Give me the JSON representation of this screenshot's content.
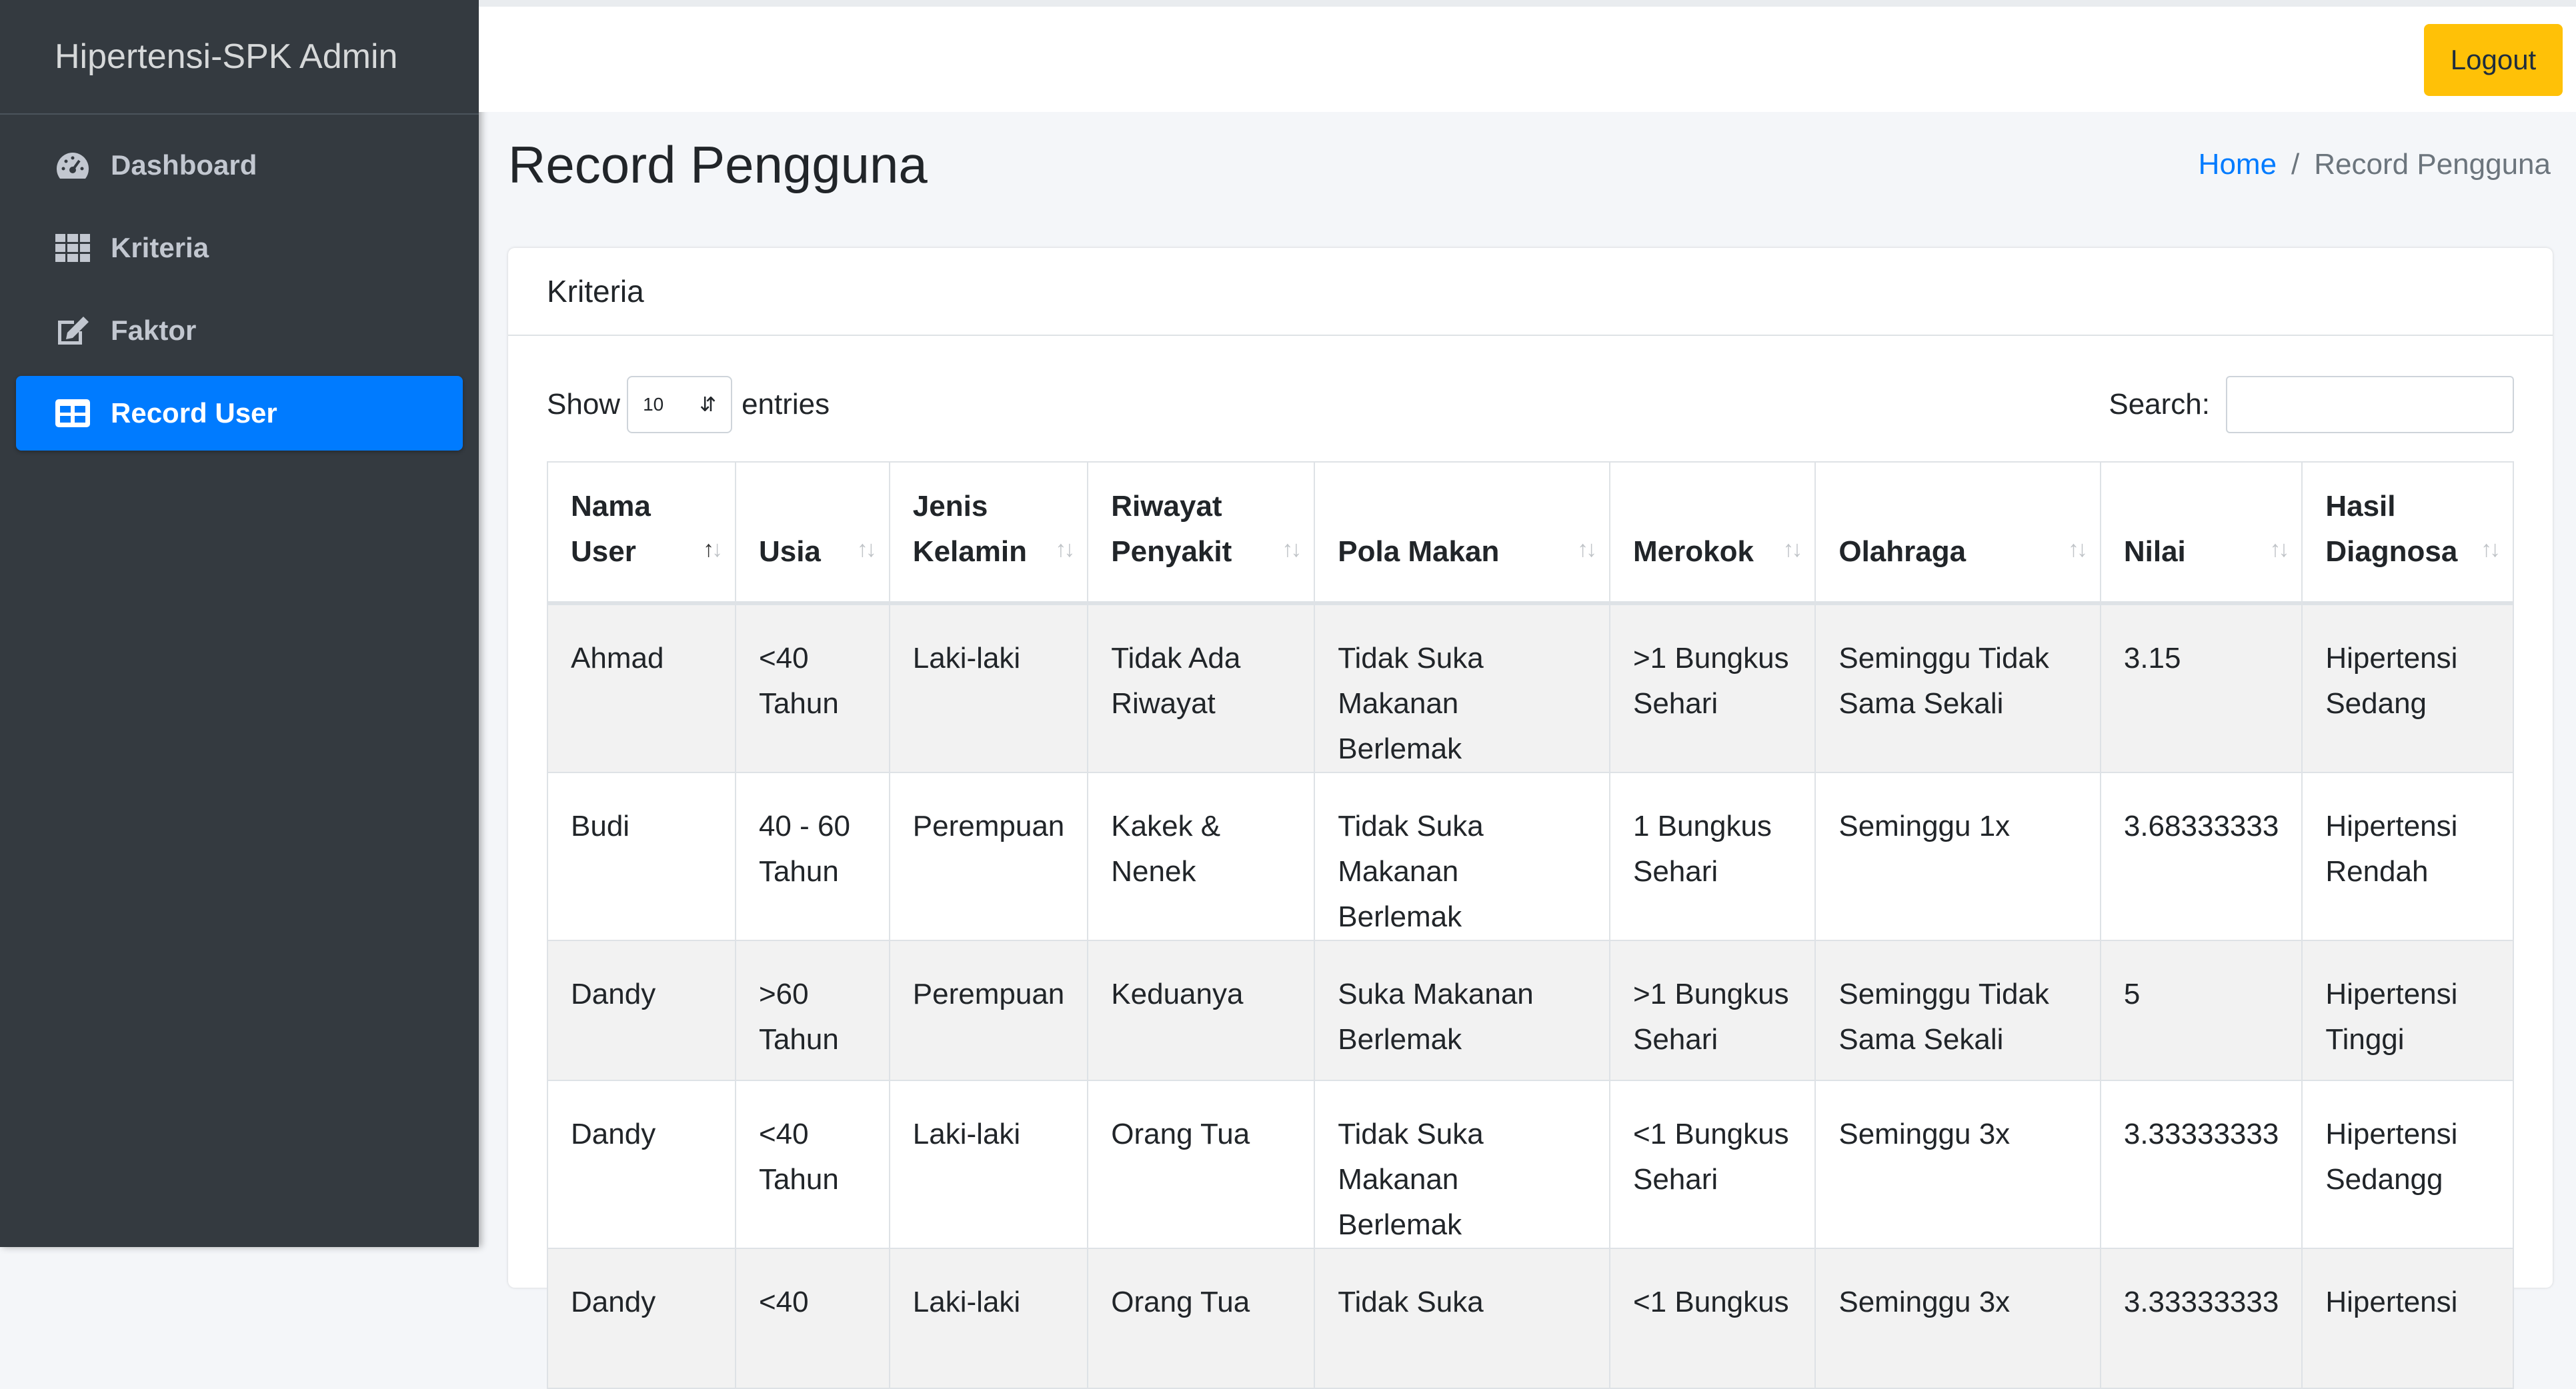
{
  "brand": "Hipertensi-SPK Admin",
  "sidebar": {
    "items": [
      {
        "label": "Dashboard",
        "icon": "tachometer-icon"
      },
      {
        "label": "Kriteria",
        "icon": "grid-icon"
      },
      {
        "label": "Faktor",
        "icon": "edit-icon"
      },
      {
        "label": "Record User",
        "icon": "table-icon",
        "active": true
      }
    ]
  },
  "topbar": {
    "logout_label": "Logout"
  },
  "header": {
    "title": "Record Pengguna",
    "breadcrumb": {
      "home": "Home",
      "separator": "/",
      "current": "Record Pengguna"
    }
  },
  "card": {
    "title": "Kriteria",
    "show_label": "Show",
    "entries_value": "10",
    "entries_label": "entries",
    "search_label": "Search:",
    "search_value": ""
  },
  "table": {
    "columns": [
      {
        "line1": "Nama",
        "line2": "User",
        "sort": "asc"
      },
      {
        "line1": "",
        "line2": "Usia"
      },
      {
        "line1": "Jenis",
        "line2": "Kelamin"
      },
      {
        "line1": "Riwayat",
        "line2": "Penyakit"
      },
      {
        "line1": "",
        "line2": "Pola Makan"
      },
      {
        "line1": "",
        "line2": "Merokok"
      },
      {
        "line1": "",
        "line2": "Olahraga"
      },
      {
        "line1": "",
        "line2": "Nilai"
      },
      {
        "line1": "Hasil",
        "line2": "Diagnosa"
      }
    ],
    "rows": [
      {
        "nama": "Ahmad",
        "usia1": "<40",
        "usia2": "Tahun",
        "jk": "Laki-laki",
        "rp1": "Tidak Ada",
        "rp2": "Riwayat",
        "pm1": "Tidak Suka",
        "pm2": "Makanan Berlemak",
        "mr1": ">1 Bungkus",
        "mr2": "Sehari",
        "ol1": "Seminggu Tidak",
        "ol2": "Sama Sekali",
        "nilai": "3.15",
        "hd1": "Hipertensi",
        "hd2": "Sedang"
      },
      {
        "nama": "Budi",
        "usia1": "40 - 60",
        "usia2": "Tahun",
        "jk": "Perempuan",
        "rp1": "Kakek &",
        "rp2": "Nenek",
        "pm1": "Tidak Suka",
        "pm2": "Makanan Berlemak",
        "mr1": "1 Bungkus",
        "mr2": "Sehari",
        "ol1": "Seminggu 1x",
        "ol2": "",
        "nilai": "3.68333333",
        "hd1": "Hipertensi",
        "hd2": "Rendah"
      },
      {
        "nama": "Dandy",
        "usia1": ">60",
        "usia2": "Tahun",
        "jk": "Perempuan",
        "rp1": "Keduanya",
        "rp2": "",
        "pm1": "Suka Makanan",
        "pm2": "Berlemak",
        "mr1": ">1 Bungkus",
        "mr2": "Sehari",
        "ol1": "Seminggu Tidak",
        "ol2": "Sama Sekali",
        "nilai": "5",
        "hd1": "Hipertensi",
        "hd2": "Tinggi"
      },
      {
        "nama": "Dandy",
        "usia1": "<40",
        "usia2": "Tahun",
        "jk": "Laki-laki",
        "rp1": "Orang Tua",
        "rp2": "",
        "pm1": "Tidak Suka",
        "pm2": "Makanan Berlemak",
        "mr1": "<1 Bungkus",
        "mr2": "Sehari",
        "ol1": "Seminggu 3x",
        "ol2": "",
        "nilai": "3.33333333",
        "hd1": "Hipertensi",
        "hd2": "Sedangg"
      },
      {
        "nama": "Dandy",
        "usia1": "<40",
        "usia2": "",
        "jk": "Laki-laki",
        "rp1": "Orang Tua",
        "rp2": "",
        "pm1": "Tidak Suka",
        "pm2": "",
        "mr1": "<1 Bungkus",
        "mr2": "",
        "ol1": "Seminggu 3x",
        "ol2": "",
        "nilai": "3.33333333",
        "hd1": "Hipertensi",
        "hd2": ""
      }
    ]
  },
  "colors": {
    "sidebar_bg": "#343a40",
    "active": "#007bff",
    "logout": "#ffc107",
    "link": "#007bff"
  }
}
